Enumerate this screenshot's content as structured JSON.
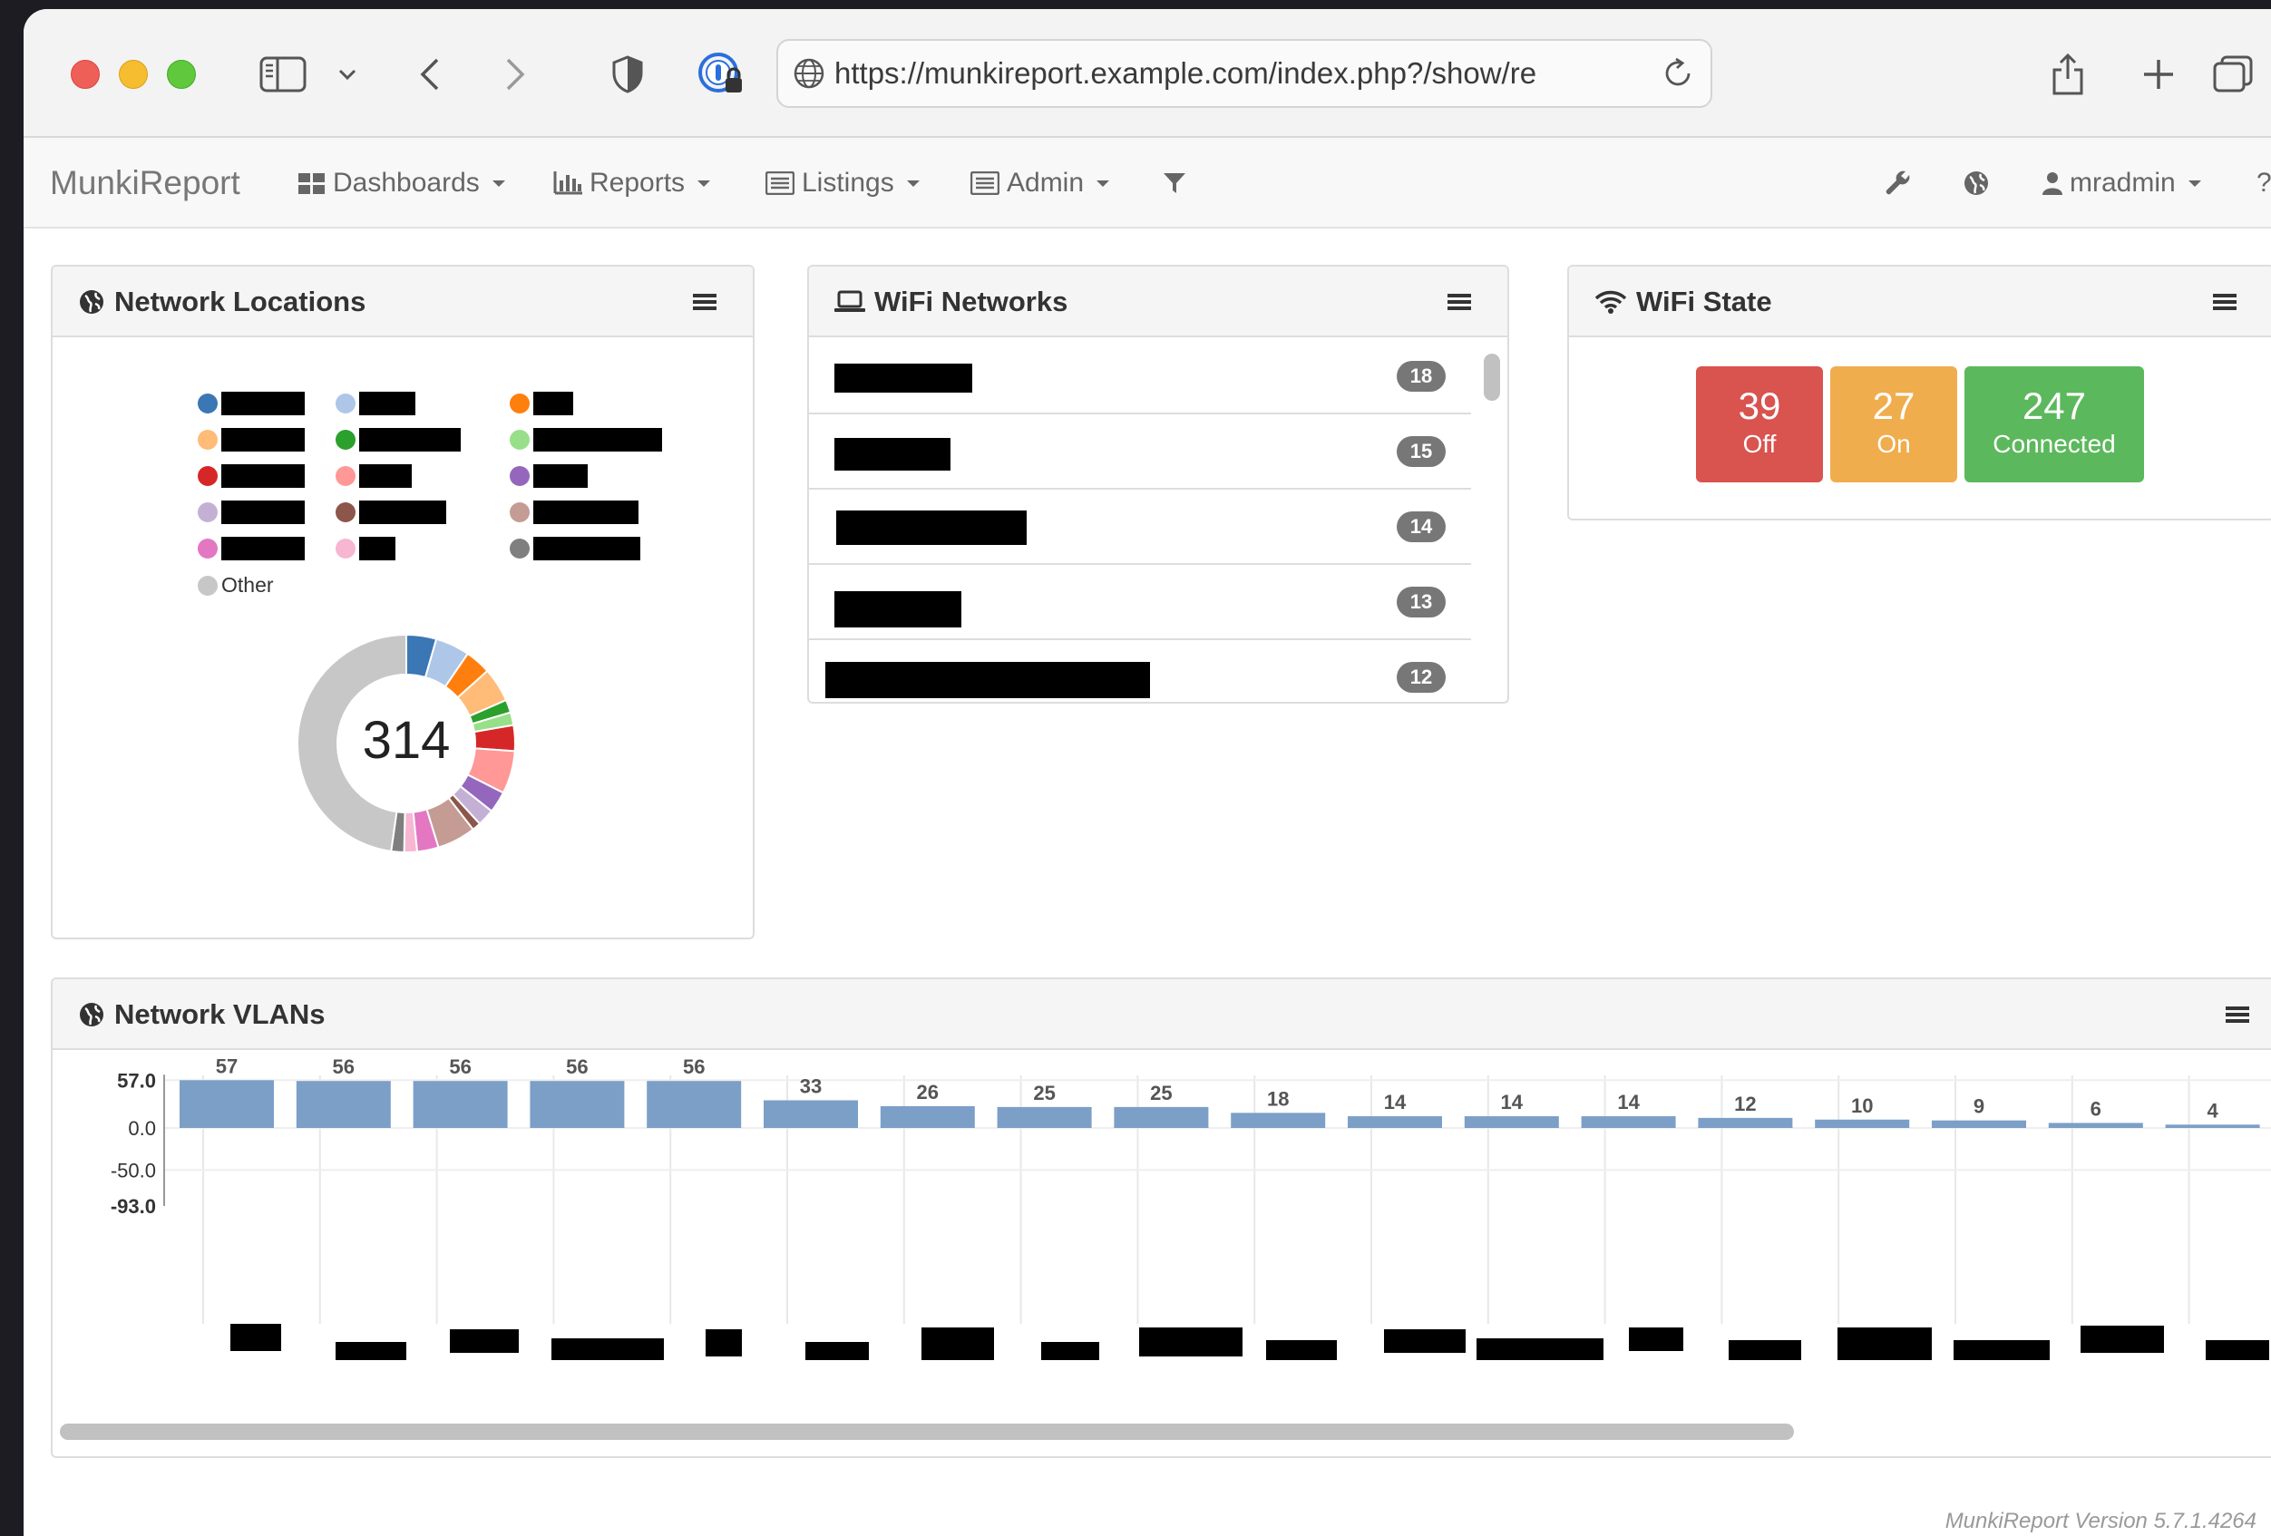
{
  "browser": {
    "url": "https://munkireport.example.com/index.php?/show/re"
  },
  "navbar": {
    "brand": "MunkiReport",
    "menus": [
      "Dashboards",
      "Reports",
      "Listings",
      "Admin"
    ],
    "user": "mradmin",
    "help": "?"
  },
  "network_locations": {
    "title": "Network Locations",
    "total": "314",
    "other_label": "Other",
    "legend_colors": [
      "#3b76b5",
      "#aec7e8",
      "#ff7f0e",
      "#ffbb78",
      "#2ca02c",
      "#98df8a",
      "#d62728",
      "#ff9896",
      "#9467bd",
      "#c5b0d5",
      "#8c564b",
      "#c49c94",
      "#e377c2",
      "#f7b6d2",
      "#7f7f7f",
      "#c7c7c7"
    ]
  },
  "wifi_networks": {
    "title": "WiFi Networks",
    "counts": [
      "18",
      "15",
      "14",
      "13",
      "12"
    ]
  },
  "wifi_state": {
    "title": "WiFi State",
    "items": [
      {
        "value": "39",
        "label": "Off",
        "color": "#d9534f"
      },
      {
        "value": "27",
        "label": "On",
        "color": "#f0ad4e"
      },
      {
        "value": "247",
        "label": "Connected",
        "color": "#5cb85c"
      }
    ]
  },
  "network_vlans": {
    "title": "Network VLANs"
  },
  "chart_data": {
    "type": "bar",
    "values": [
      57,
      56,
      56,
      56,
      56,
      33,
      26,
      25,
      25,
      18,
      14,
      14,
      14,
      12,
      10,
      9,
      6,
      4
    ],
    "value_labels": [
      "57",
      "56",
      "56",
      "56",
      "56",
      "33",
      "26",
      "25",
      "25",
      "18",
      "14",
      "14",
      "14",
      "12",
      "10",
      "9",
      "6",
      "4"
    ],
    "ytick_labels": [
      "57.0",
      "0.0",
      "-50.0",
      "-93.0"
    ],
    "ylim": [
      -93,
      57
    ],
    "bar_color": "#7c9fc7",
    "grid": true
  },
  "footer": "MunkiReport Version 5.7.1.4264"
}
